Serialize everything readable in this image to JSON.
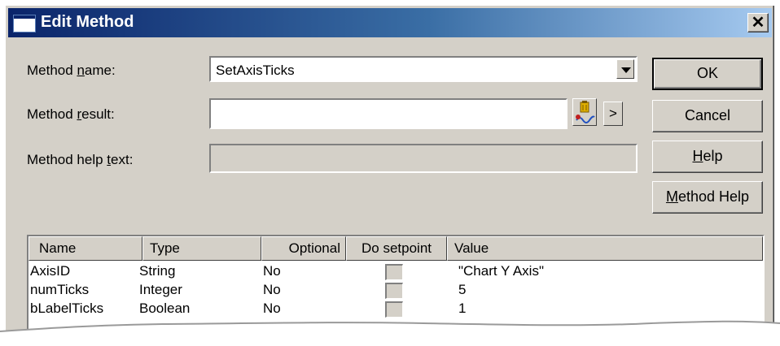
{
  "window": {
    "title": "Edit Method",
    "close_glyph": "✕"
  },
  "fields": {
    "method_name": {
      "label_pre": "Method ",
      "label_key": "n",
      "label_post": "ame:",
      "value": "SetAxisTicks"
    },
    "method_result": {
      "label_pre": "Method ",
      "label_key": "r",
      "label_post": "esult:",
      "value": ""
    },
    "method_help": {
      "label_pre": "Method help ",
      "label_key": "t",
      "label_post": "ext:",
      "value": ""
    }
  },
  "buttons": {
    "ok": "OK",
    "cancel": "Cancel",
    "help_key": "H",
    "help_rest": "elp",
    "method_help_key": "M",
    "method_help_rest": "ethod Help",
    "arrow": ">"
  },
  "table": {
    "columns": [
      "Name",
      "Type",
      "Optional",
      "Do setpoint",
      "Value"
    ],
    "rows": [
      {
        "name": "AxisID",
        "type": "String",
        "optional": "No",
        "setpoint": false,
        "value": "\"Chart Y Axis\""
      },
      {
        "name": "numTicks",
        "type": "Integer",
        "optional": "No",
        "setpoint": false,
        "value": "5"
      },
      {
        "name": "bLabelTicks",
        "type": "Boolean",
        "optional": "No",
        "setpoint": false,
        "value": "1"
      }
    ]
  },
  "icons": {
    "browse": "tag-browser-icon",
    "combo": "chevron-down-icon",
    "close": "close-icon"
  }
}
